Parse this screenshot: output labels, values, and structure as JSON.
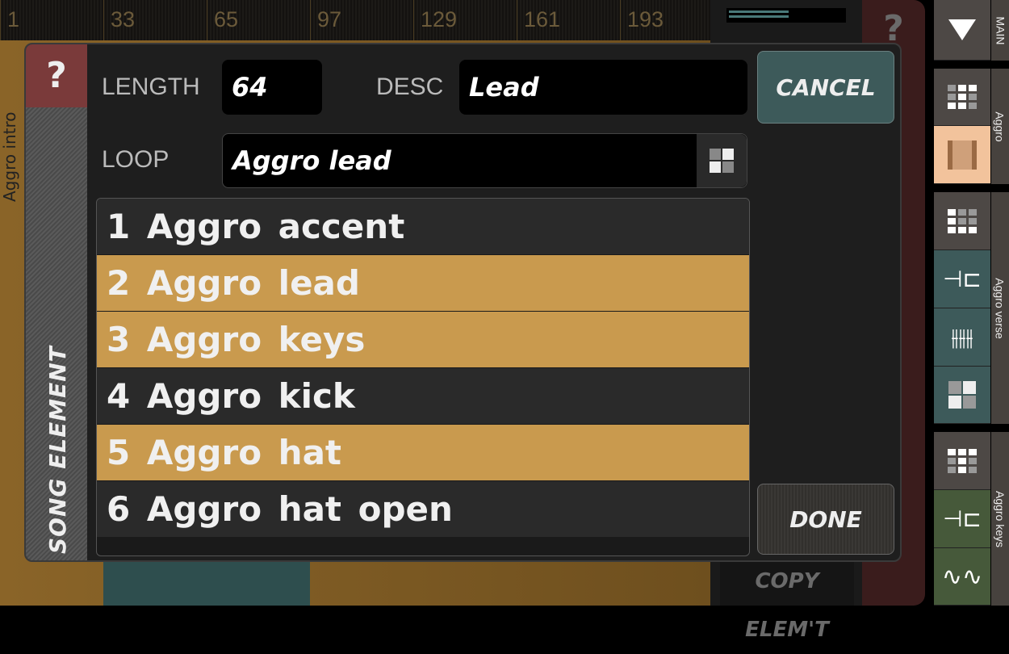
{
  "timeline": {
    "ticks": [
      "1",
      "33",
      "65",
      "97",
      "129",
      "161",
      "193"
    ]
  },
  "background": {
    "track_label": "Aggro intro",
    "help": "?",
    "copy_button": "COPY ELEM'T"
  },
  "dialog": {
    "help": "?",
    "side_label": "SONG ELEMENT",
    "length_label": "LENGTH",
    "length_value": "64",
    "desc_label": "DESC",
    "desc_value": "Lead",
    "loop_label": "LOOP",
    "loop_value": "Aggro lead",
    "cancel": "CANCEL",
    "done": "DONE",
    "loops": [
      {
        "label": "1 Aggro accent",
        "selected": false
      },
      {
        "label": "2 Aggro lead",
        "selected": true
      },
      {
        "label": "3 Aggro keys",
        "selected": true
      },
      {
        "label": "4 Aggro kick",
        "selected": false
      },
      {
        "label": "5 Aggro hat",
        "selected": true
      },
      {
        "label": "6 Aggro hat open",
        "selected": false
      }
    ]
  },
  "sidebar": {
    "sections": [
      "MAIN",
      "Aggro",
      "Aggro verse",
      "Aggro keys"
    ]
  },
  "colors": {
    "selected": "#c99a4e",
    "teal": "#3d5a5a",
    "green": "#46593a",
    "peach": "#f2c39c",
    "help_red": "#7a3a3a"
  }
}
